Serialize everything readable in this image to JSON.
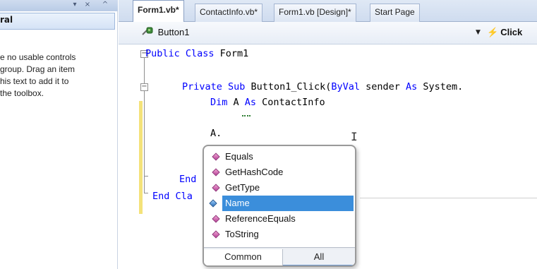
{
  "toolbox": {
    "title_buttons": [
      "▾",
      "×",
      "^"
    ],
    "group_label": "ral",
    "empty_message_lines": [
      "e no usable controls",
      "group. Drag an item",
      "his text to add it to",
      " the toolbox."
    ]
  },
  "tabs": [
    {
      "label": "Form1.vb*",
      "active": true
    },
    {
      "label": "ContactInfo.vb*",
      "active": false
    },
    {
      "label": "Form1.vb [Design]*",
      "active": false
    },
    {
      "label": "Start Page",
      "active": false
    }
  ],
  "navbar": {
    "object_label": "Button1",
    "dropdown_arrow": "▼",
    "event_label": "Click",
    "event_icon": "lightning-bolt-icon"
  },
  "code": {
    "line1_kw": "Public Class",
    "line1_rest": " Form1",
    "line2_kw1": "Private Sub",
    "line2_mid": " Button1_Click(",
    "line2_kw2": "ByVal",
    "line2_mid2": " sender ",
    "line2_kw3": "As",
    "line2_end": " System.",
    "line3_kw1": "Dim",
    "line3_mid": " A ",
    "line3_kw2": "As",
    "line3_end": " ContactInfo",
    "line4": "A.",
    "line5_kw": "End",
    "line6_kw": "End Cla"
  },
  "intellisense": {
    "items": [
      {
        "label": "Equals",
        "icon": "method-icon",
        "selected": false
      },
      {
        "label": "GetHashCode",
        "icon": "method-icon",
        "selected": false
      },
      {
        "label": "GetType",
        "icon": "method-icon",
        "selected": false
      },
      {
        "label": "Name",
        "icon": "field-icon",
        "selected": true
      },
      {
        "label": "ReferenceEquals",
        "icon": "method-icon",
        "selected": false
      },
      {
        "label": "ToString",
        "icon": "method-icon",
        "selected": false
      }
    ],
    "tab_common": "Common",
    "tab_all": "All",
    "selection_color": "#3b8edb"
  },
  "colors": {
    "keyword": "#0000ff",
    "change_bar": "#f4e27a"
  }
}
